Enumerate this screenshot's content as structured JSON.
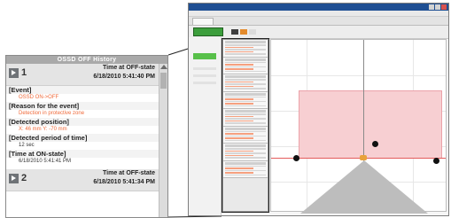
{
  "history_panel": {
    "title": "OSSD OFF History",
    "records": [
      {
        "number": "1",
        "time_at_off_label": "Time at OFF-state",
        "time_at_off_value": "6/18/2010 5:41:40 PM",
        "event_label": "[Event]",
        "event_value": "OSSD ON->OFF",
        "reason_label": "[Reason for the event]",
        "reason_value": "Detection in protective zone",
        "detected_position_label": "[Detected position]",
        "detected_position_value": "X: 46 mm Y: -70 mm",
        "detected_period_label": "[Detected period of time]",
        "detected_period_value": "12 sec",
        "time_on_label": "[Time at ON-state]",
        "time_on_value": "6/18/2010 5:41:41 PM"
      },
      {
        "number": "2",
        "time_at_off_label": "Time at OFF-state",
        "time_at_off_value": "6/18/2010 5:41:34 PM"
      }
    ]
  },
  "colors": {
    "red_text": "#f06a3a",
    "protective_zone": "#f7cfd2",
    "warning_zone": "#bdbdbd",
    "green_button": "#3c9e3c"
  },
  "icons": {
    "record_play": "play-icon",
    "scroll_up": "scroll-up-arrow-icon"
  }
}
